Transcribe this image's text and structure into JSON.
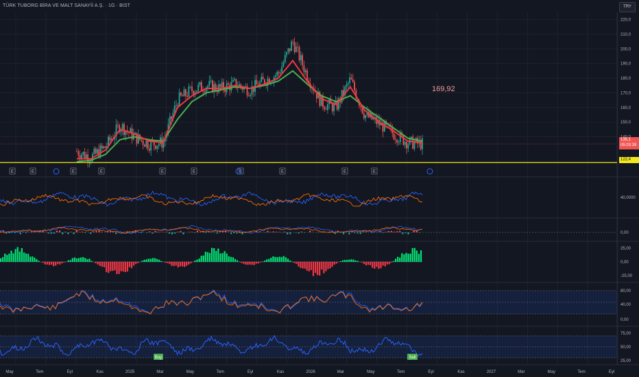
{
  "header": {
    "title": "TÜRK TUBORG BİRA VE MALT SANAYİİ A.Ş. · 1G · BIST",
    "currency": "TRY"
  },
  "price_pane": {
    "last_price": "135,1",
    "countdown": "05:03:39",
    "level_price": "122,4",
    "peak_label": "169,92",
    "event_markers": [
      "E",
      "E",
      "E",
      "E",
      "E",
      "E",
      "E",
      "E",
      "E",
      "E"
    ],
    "colors": {
      "up": "#26a69a",
      "down": "#ef5350",
      "ma_fast": "#f23645",
      "ma_slow": "#4caf50",
      "level": "#f4e71b",
      "tag": "#f05350"
    }
  },
  "x_axis": {
    "labels": [
      "May",
      "Tem",
      "Eyl",
      "Kas",
      "2025",
      "Mar",
      "May",
      "Tem",
      "Eyl",
      "Kas",
      "2026",
      "Mar",
      "May",
      "Tem",
      "Eyl",
      "Kas",
      "2027",
      "Mar",
      "May",
      "Tem",
      "Eyl"
    ]
  },
  "indicators": {
    "pane1_label": "40,0000",
    "pane2_label": "0,00",
    "pane3_labels": [
      "25,00",
      "0,00",
      "-25,00"
    ],
    "pane4_labels": [
      "80,00",
      "40,00",
      "0,00"
    ],
    "pane5_labels": [
      "75,00",
      "50,00",
      "25,00"
    ],
    "signal_buy": "Buy",
    "signal_sell": "Sell",
    "colors": {
      "blue": "#2962ff",
      "orange": "#ff6d00",
      "green": "#00e676",
      "red": "#f23645"
    }
  },
  "chart_data": {
    "type": "line",
    "title": "TÜRK TUBORG BİRA VE MALT SANAYİİ A.Ş. · 1G · BIST",
    "xlabel": "",
    "ylabel": "",
    "x": [
      "2024-08",
      "2024-09",
      "2024-10",
      "2024-11",
      "2024-12",
      "2025-01",
      "2025-02",
      "2025-03",
      "2025-04",
      "2025-05",
      "2025-06",
      "2025-07",
      "2025-08",
      "2025-09",
      "2025-10",
      "2025-11",
      "2025-12",
      "2026-01",
      "2026-02",
      "2026-03",
      "2026-04",
      "2026-05",
      "2026-06",
      "2026-07",
      "2026-08"
    ],
    "series": [
      {
        "name": "",
        "values": [
          130,
          126,
          133,
          148,
          140,
          135,
          136,
          165,
          172,
          175,
          173,
          176,
          172,
          178,
          183,
          205,
          182,
          163,
          160,
          179,
          155,
          149,
          142,
          136,
          135
        ]
      },
      {
        "name": "",
        "values": [
          125,
          125,
          131,
          145,
          142,
          137,
          136,
          160,
          168,
          173,
          173,
          175,
          173,
          176,
          180,
          192,
          178,
          166,
          162,
          174,
          158,
          150,
          144,
          137,
          136
        ]
      },
      {
        "name": "",
        "values": [
          123,
          124,
          128,
          138,
          140,
          138,
          137,
          152,
          164,
          170,
          172,
          174,
          173,
          175,
          178,
          185,
          176,
          168,
          164,
          168,
          160,
          153,
          146,
          139,
          137
        ]
      }
    ],
    "ylim": [
      122,
      224
    ],
    "y_ticks": [
      "220,0",
      "210,0",
      "200,0",
      "190,0",
      "180,0",
      "170,0",
      "160,0",
      "150,0",
      "140,0"
    ],
    "horizontal_level": 122.4,
    "grid": true,
    "legend": "none"
  }
}
